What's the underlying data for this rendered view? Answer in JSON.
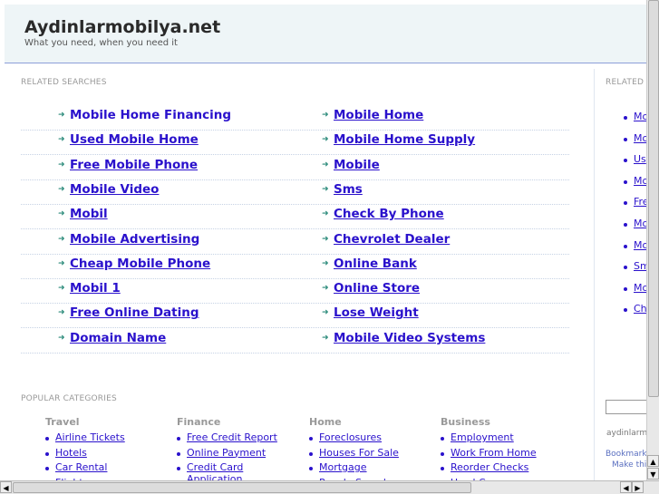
{
  "header": {
    "title": "Aydinlarmobilya.net",
    "tagline": "What you need, when you need it"
  },
  "related": {
    "label": "RELATED SEARCHES",
    "left": [
      "Mobile Home Financing",
      "Used Mobile Home",
      "Free Mobile Phone",
      "Mobile Video",
      "Mobil",
      "Mobile Advertising",
      "Cheap Mobile Phone",
      "Mobil 1",
      "Free Online Dating",
      "Domain Name"
    ],
    "right": [
      "Mobile Home",
      "Mobile Home Supply",
      "Mobile",
      "Sms",
      "Check By Phone",
      "Chevrolet Dealer",
      "Online Bank",
      "Online Store",
      "Lose Weight",
      "Mobile Video Systems"
    ]
  },
  "popular": {
    "label": "POPULAR CATEGORIES",
    "columns": [
      {
        "title": "Travel",
        "items": [
          "Airline Tickets",
          "Hotels",
          "Car Rental",
          "Flights"
        ]
      },
      {
        "title": "Finance",
        "items": [
          "Free Credit Report",
          "Online Payment",
          "Credit Card Application"
        ]
      },
      {
        "title": "Home",
        "items": [
          "Foreclosures",
          "Houses For Sale",
          "Mortgage",
          "People Search"
        ]
      },
      {
        "title": "Business",
        "items": [
          "Employment",
          "Work From Home",
          "Reorder Checks",
          "Used Cars"
        ]
      }
    ]
  },
  "sidebar": {
    "label": "RELATED",
    "items": [
      "Mo",
      "Mo",
      "Us",
      "Mo",
      "Fre",
      "Mo",
      "Mo",
      "Sm",
      "Mo",
      "Ch"
    ],
    "domain_text": "aydinlarm",
    "bookmark": "Bookmark",
    "make": "Make thi"
  },
  "colors": {
    "link": "#2a11cc",
    "header_bg": "#eef5f7",
    "arrow": "#2a8a7a"
  }
}
